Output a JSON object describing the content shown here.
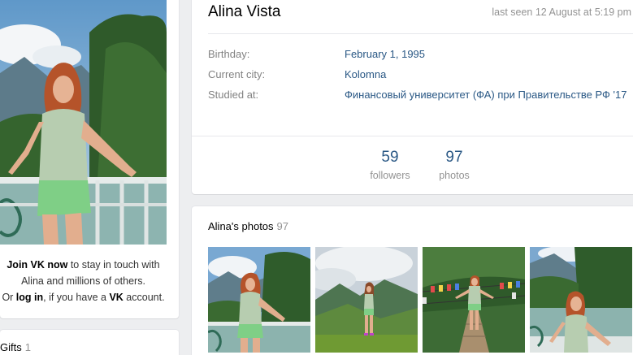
{
  "join": {
    "join_link": "Join VK now",
    "join_rest": " to stay in touch with Alina and millions of others.",
    "or": "Or ",
    "login_link": "log in",
    "mid": ", if you have a ",
    "vk": "VK",
    "end": " account."
  },
  "gifts": {
    "title": "Gifts",
    "count": "1"
  },
  "profile": {
    "name": "Alina Vista",
    "last_seen": "last seen 12 August at 5:19 pm",
    "info": [
      {
        "label": "Birthday:",
        "value": "February 1, 1995"
      },
      {
        "label": "Current city:",
        "value": "Kolomna"
      },
      {
        "label": "Studied at:",
        "value": "Финансовый университет (ФА) при Правительстве РФ '17"
      }
    ],
    "counters": [
      {
        "number": "59",
        "label": "followers"
      },
      {
        "number": "97",
        "label": "photos"
      }
    ]
  },
  "photos": {
    "title": "Alina's photos",
    "count": "97"
  }
}
